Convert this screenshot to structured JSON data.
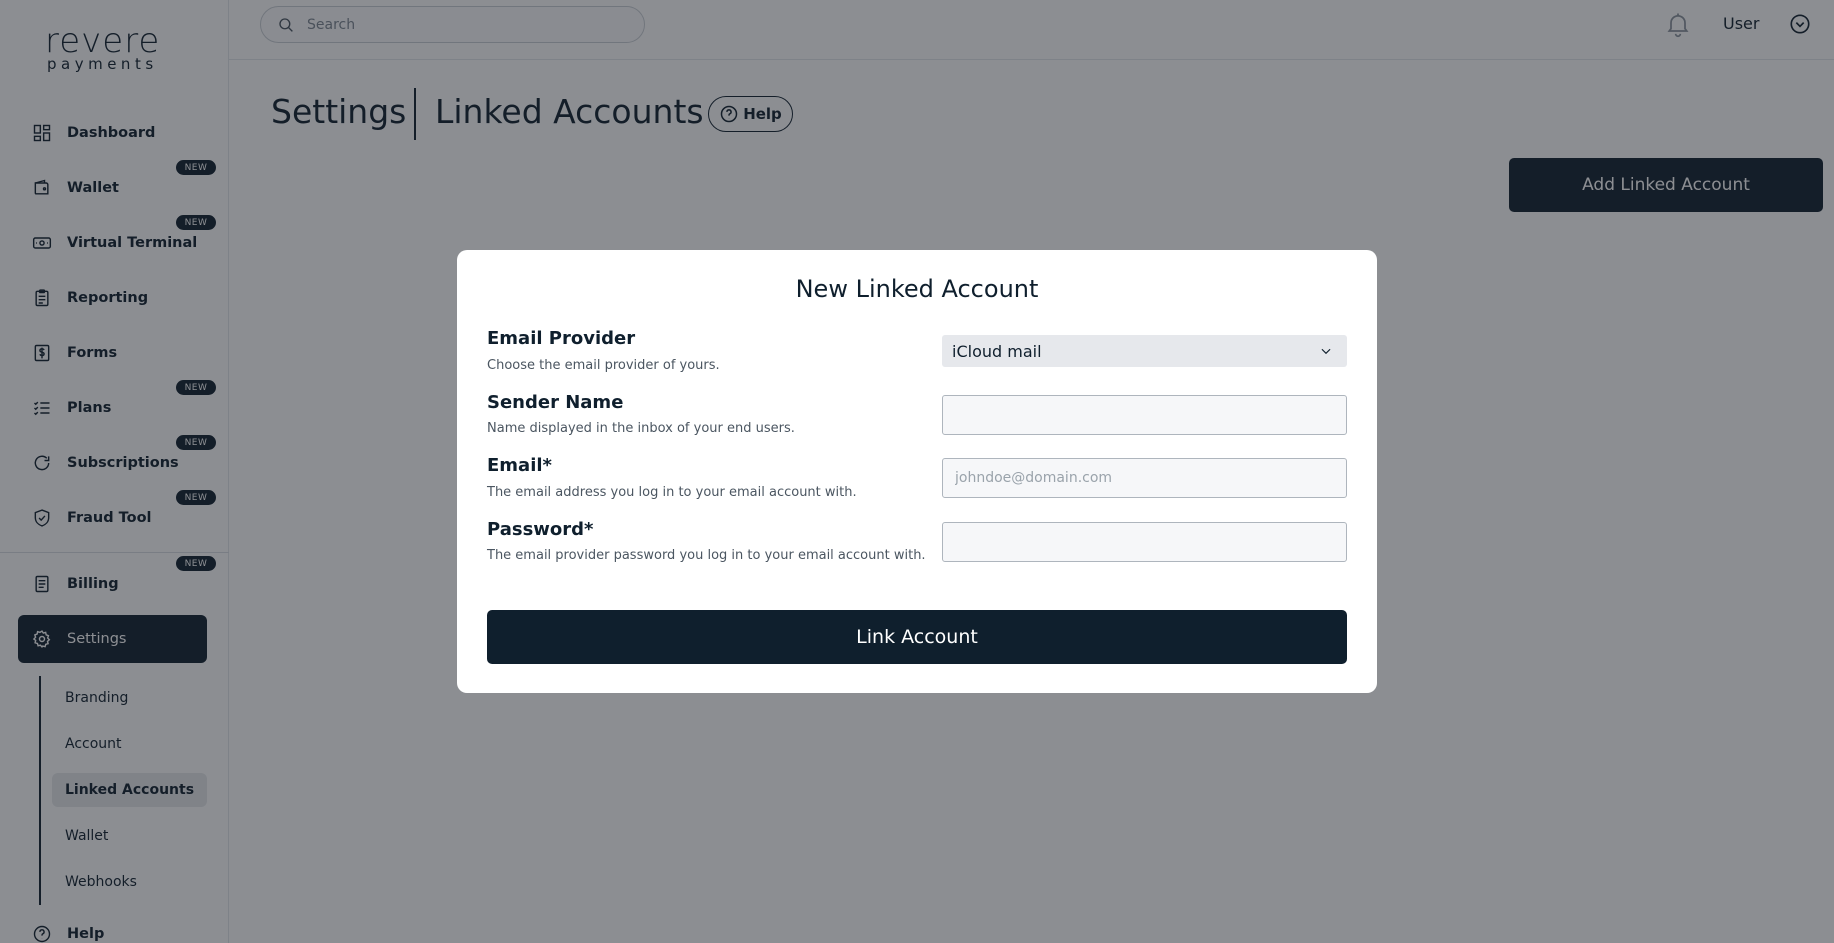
{
  "brand": {
    "logo_line1": "revere",
    "logo_line2": "payments"
  },
  "sidebar": {
    "items": [
      {
        "label": "Dashboard",
        "icon": "dashboard-icon",
        "badge": ""
      },
      {
        "label": "Wallet",
        "icon": "wallet-icon",
        "badge": "NEW"
      },
      {
        "label": "Virtual Terminal",
        "icon": "terminal-icon",
        "badge": "NEW"
      },
      {
        "label": "Reporting",
        "icon": "clipboard-icon",
        "badge": ""
      },
      {
        "label": "Forms",
        "icon": "dollar-file-icon",
        "badge": ""
      },
      {
        "label": "Plans",
        "icon": "checklist-icon",
        "badge": "NEW"
      },
      {
        "label": "Subscriptions",
        "icon": "refresh-icon",
        "badge": "NEW"
      },
      {
        "label": "Fraud Tool",
        "icon": "shield-check-icon",
        "badge": "NEW"
      },
      {
        "label": "Billing",
        "icon": "receipt-icon",
        "badge": "NEW"
      },
      {
        "label": "Settings",
        "icon": "gear-icon",
        "badge": ""
      }
    ],
    "settings_sub": [
      {
        "label": "Branding"
      },
      {
        "label": "Account"
      },
      {
        "label": "Linked Accounts"
      },
      {
        "label": "Wallet"
      },
      {
        "label": "Webhooks"
      }
    ],
    "help_label": "Help"
  },
  "topbar": {
    "search_placeholder": "Search",
    "user_label": "User"
  },
  "page": {
    "title": "Settings",
    "subtitle": "Linked Accounts",
    "help_label": "Help",
    "add_button": "Add Linked Account"
  },
  "modal": {
    "title": "New Linked Account",
    "fields": {
      "provider": {
        "label": "Email Provider",
        "desc": "Choose the email provider of yours.",
        "value": "iCloud mail"
      },
      "sender": {
        "label": "Sender Name",
        "desc": "Name displayed in the inbox of your end users.",
        "value": "",
        "placeholder": ""
      },
      "email": {
        "label": "Email*",
        "desc": "The email address you log in to your email account with.",
        "value": "",
        "placeholder": "johndoe@domain.com"
      },
      "password": {
        "label": "Password*",
        "desc": "The email provider password you log in to your email account with.",
        "value": "",
        "placeholder": ""
      }
    },
    "submit_label": "Link Account"
  },
  "colors": {
    "primary": "#0f1f2d",
    "overlay": "rgba(25,30,38,0.5)"
  }
}
